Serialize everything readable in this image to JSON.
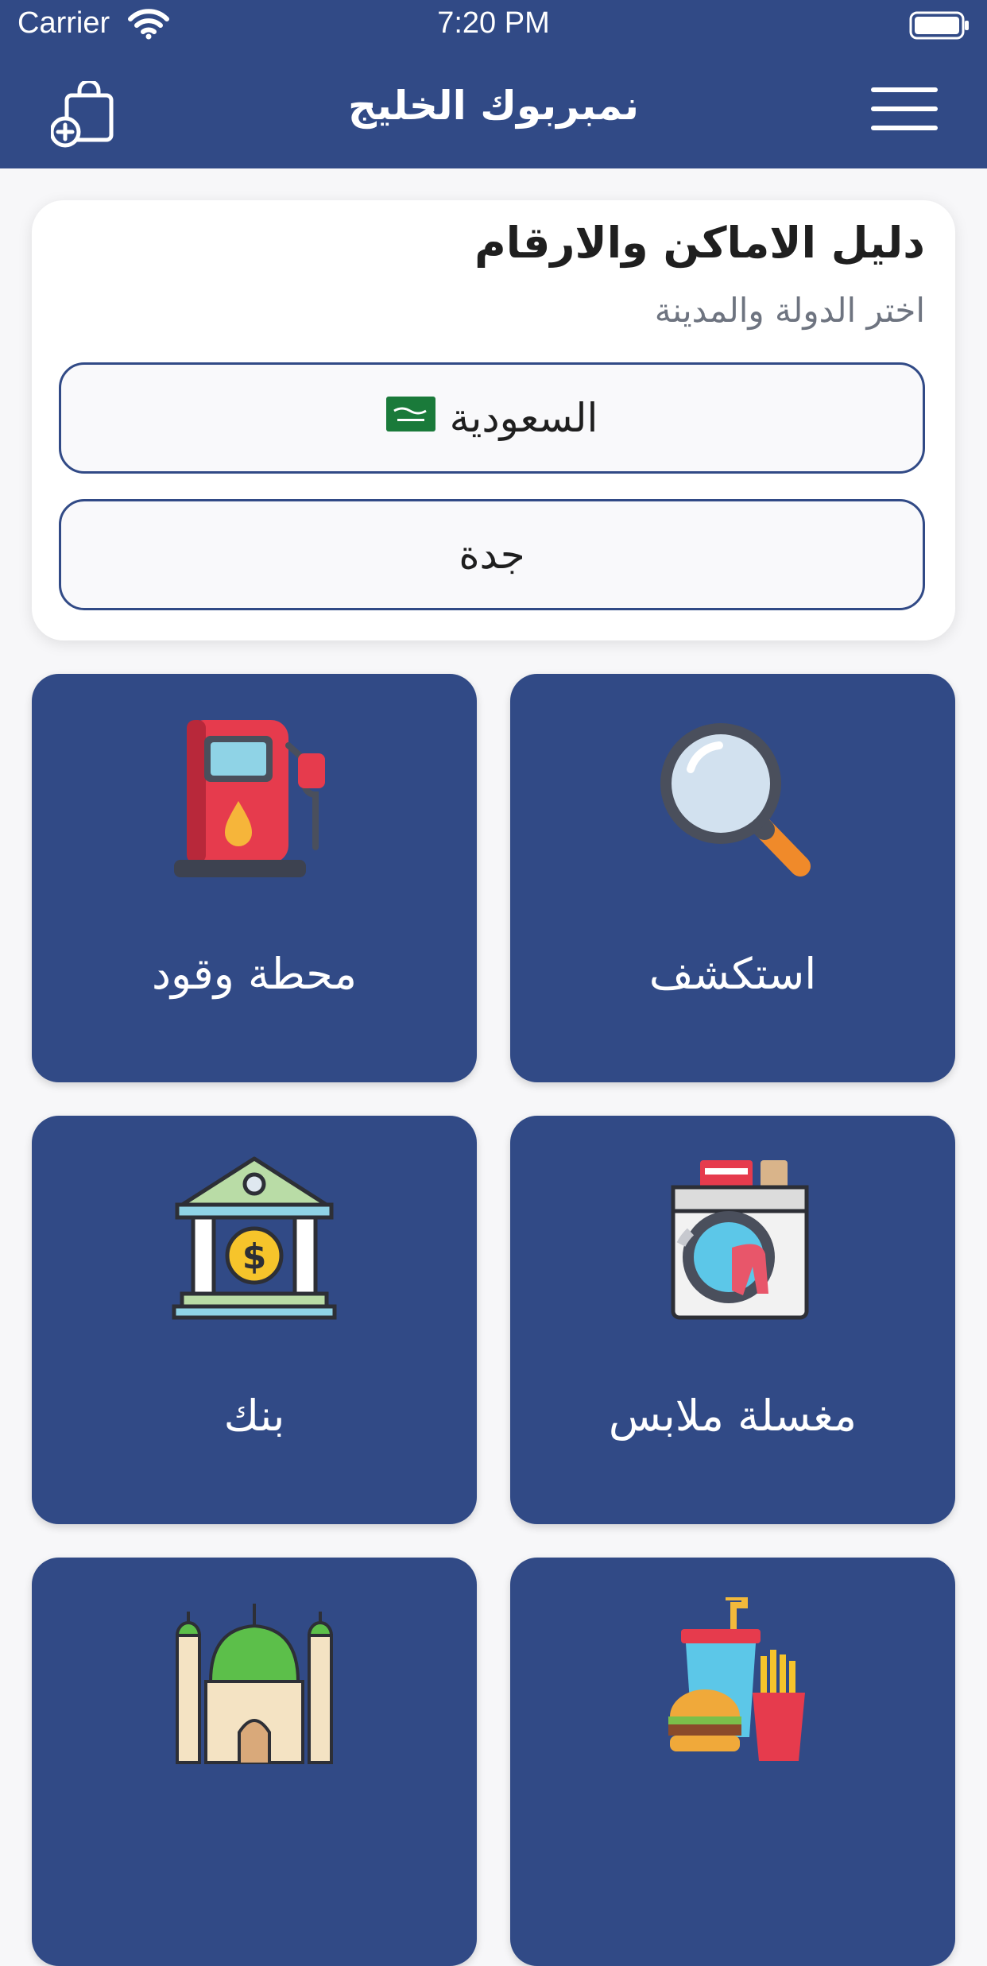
{
  "status_bar": {
    "carrier": "Carrier",
    "time": "7:20 PM"
  },
  "nav": {
    "title": "نمبربوك الخليج",
    "left_icon": "add-bag-icon",
    "right_icon": "menu-icon"
  },
  "selector": {
    "heading": "دليل الاماكن والارقام",
    "subheading": "اختر الدولة والمدينة",
    "country": "السعودية",
    "country_flag": "saudi-flag-icon",
    "city": "جدة"
  },
  "categories": [
    {
      "label": "استكشف",
      "icon": "magnifier-icon"
    },
    {
      "label": "محطة وقود",
      "icon": "fuel-pump-icon"
    },
    {
      "label": "مغسلة ملابس",
      "icon": "washing-machine-icon"
    },
    {
      "label": "بنك",
      "icon": "bank-icon"
    },
    {
      "label": "",
      "icon": "fast-food-icon"
    },
    {
      "label": "",
      "icon": "mosque-icon"
    }
  ],
  "colors": {
    "primary": "#314a86",
    "background": "#f7f7f9",
    "card": "#ffffff"
  }
}
